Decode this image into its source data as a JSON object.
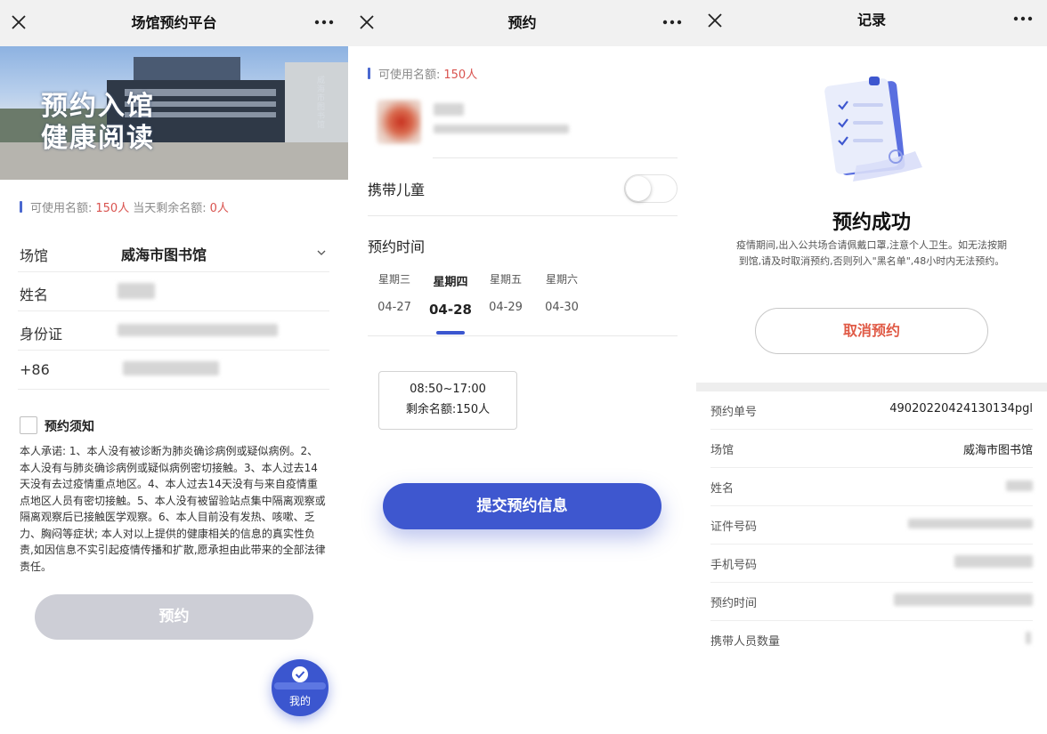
{
  "left": {
    "nav_title": "场馆预约平台",
    "hero_line1": "预约入馆",
    "hero_line2": "健康阅读",
    "hero_vertical": "威海市图书馆",
    "quota": {
      "label_avail": "可使用名额:",
      "avail": "150人",
      "label_remain": "当天剩余名额:",
      "remain": "0人"
    },
    "form": {
      "venue_label": "场馆",
      "venue_value": "威海市图书馆",
      "name_label": "姓名",
      "id_label": "身份证",
      "phone_prefix": "+86"
    },
    "notice_title": "预约须知",
    "notice_text": "本人承诺: 1、本人没有被诊断为肺炎确诊病例或疑似病例。2、本人没有与肺炎确诊病例或疑似病例密切接触。3、本人过去14天没有去过疫情重点地区。4、本人过去14天没有与来自疫情重点地区人员有密切接触。5、本人没有被留验站点集中隔离观察或隔离观察后已接触医学观察。6、本人目前没有发热、咳嗽、乏力、胸闷等症状; 本人对以上提供的健康相关的信息的真实性负责,如因信息不实引起疫情传播和扩散,愿承担由此带来的全部法律责任。",
    "submit_label": "预约",
    "fab_label": "我的"
  },
  "middle": {
    "nav_title": "预约",
    "quota_label": "可使用名额:",
    "quota_value": "150人",
    "child_label": "携带儿童",
    "time_label": "预约时间",
    "days": [
      {
        "week": "星期三",
        "date": "04-27"
      },
      {
        "week": "星期四",
        "date": "04-28"
      },
      {
        "week": "星期五",
        "date": "04-29"
      },
      {
        "week": "星期六",
        "date": "04-30"
      }
    ],
    "slot_time": "08:50~17:00",
    "slot_remain": "剩余名额:150人",
    "submit_label": "提交预约信息"
  },
  "right": {
    "nav_title": "记录",
    "success_title": "预约成功",
    "success_desc": "疫情期间,出入公共场合请佩戴口罩,注意个人卫生。如无法按期到馆,请及时取消预约,否则列入\"黑名单\",48小时内无法预约。",
    "cancel_label": "取消预约",
    "records": [
      {
        "key": "预约单号",
        "value": "49020220424130134pgl"
      },
      {
        "key": "场馆",
        "value": "威海市图书馆"
      },
      {
        "key": "姓名",
        "value": ""
      },
      {
        "key": "证件号码",
        "value": ""
      },
      {
        "key": "手机号码",
        "value": ""
      },
      {
        "key": "预约时间",
        "value": ""
      },
      {
        "key": "携带人员数量",
        "value": ""
      }
    ]
  },
  "colors": {
    "accent": "#3e57cf",
    "danger": "#e05a46",
    "disabled": "#cdced6",
    "navbar": "#f1f1f1"
  }
}
